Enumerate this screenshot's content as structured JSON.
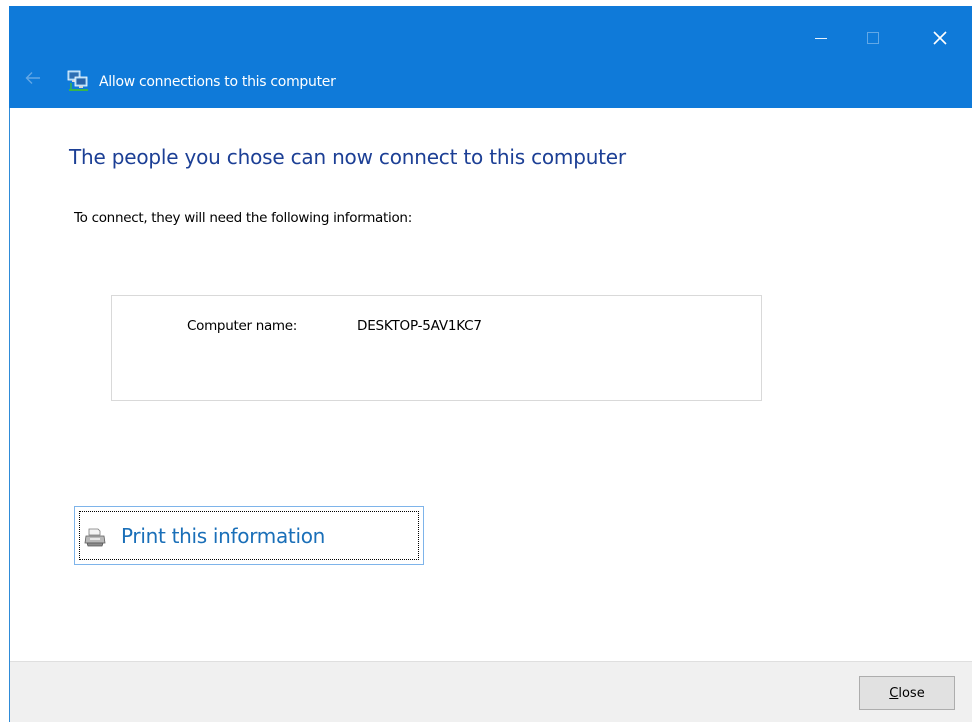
{
  "window": {
    "title": "Allow connections to this computer",
    "title_icon": "network-computer-icon",
    "controls": [
      "minimize-icon",
      "maximize-icon",
      "close-icon"
    ],
    "accent_color": "#0f7ad9"
  },
  "main": {
    "heading": "The people you chose can now connect to this computer",
    "subtext": "To connect, they will need the following information:",
    "info": {
      "label": "Computer name:",
      "value": "DESKTOP-5AV1KC7"
    },
    "print_link": {
      "label": "Print this information",
      "icon": "printer-icon"
    }
  },
  "footer": {
    "close_button": {
      "accesskey": "C",
      "rest": "lose"
    }
  }
}
